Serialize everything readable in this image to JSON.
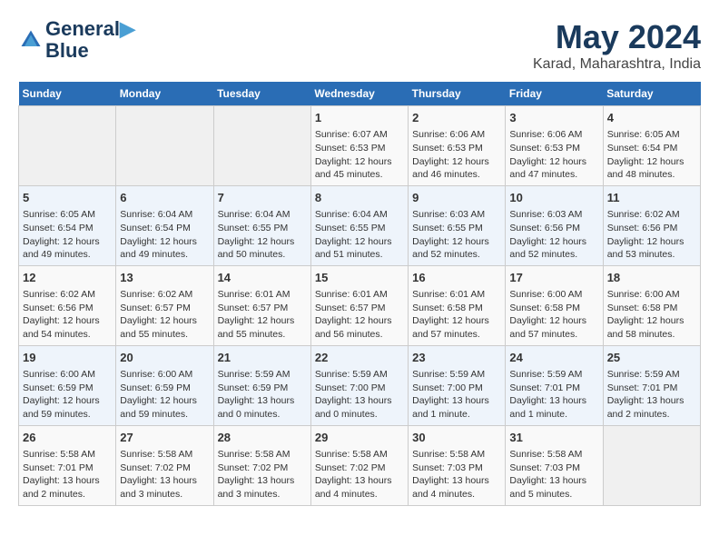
{
  "logo": {
    "line1": "General",
    "line2": "Blue"
  },
  "title": "May 2024",
  "subtitle": "Karad, Maharashtra, India",
  "days_of_week": [
    "Sunday",
    "Monday",
    "Tuesday",
    "Wednesday",
    "Thursday",
    "Friday",
    "Saturday"
  ],
  "weeks": [
    [
      {
        "day": "",
        "content": ""
      },
      {
        "day": "",
        "content": ""
      },
      {
        "day": "",
        "content": ""
      },
      {
        "day": "1",
        "content": "Sunrise: 6:07 AM\nSunset: 6:53 PM\nDaylight: 12 hours\nand 45 minutes."
      },
      {
        "day": "2",
        "content": "Sunrise: 6:06 AM\nSunset: 6:53 PM\nDaylight: 12 hours\nand 46 minutes."
      },
      {
        "day": "3",
        "content": "Sunrise: 6:06 AM\nSunset: 6:53 PM\nDaylight: 12 hours\nand 47 minutes."
      },
      {
        "day": "4",
        "content": "Sunrise: 6:05 AM\nSunset: 6:54 PM\nDaylight: 12 hours\nand 48 minutes."
      }
    ],
    [
      {
        "day": "5",
        "content": "Sunrise: 6:05 AM\nSunset: 6:54 PM\nDaylight: 12 hours\nand 49 minutes."
      },
      {
        "day": "6",
        "content": "Sunrise: 6:04 AM\nSunset: 6:54 PM\nDaylight: 12 hours\nand 49 minutes."
      },
      {
        "day": "7",
        "content": "Sunrise: 6:04 AM\nSunset: 6:55 PM\nDaylight: 12 hours\nand 50 minutes."
      },
      {
        "day": "8",
        "content": "Sunrise: 6:04 AM\nSunset: 6:55 PM\nDaylight: 12 hours\nand 51 minutes."
      },
      {
        "day": "9",
        "content": "Sunrise: 6:03 AM\nSunset: 6:55 PM\nDaylight: 12 hours\nand 52 minutes."
      },
      {
        "day": "10",
        "content": "Sunrise: 6:03 AM\nSunset: 6:56 PM\nDaylight: 12 hours\nand 52 minutes."
      },
      {
        "day": "11",
        "content": "Sunrise: 6:02 AM\nSunset: 6:56 PM\nDaylight: 12 hours\nand 53 minutes."
      }
    ],
    [
      {
        "day": "12",
        "content": "Sunrise: 6:02 AM\nSunset: 6:56 PM\nDaylight: 12 hours\nand 54 minutes."
      },
      {
        "day": "13",
        "content": "Sunrise: 6:02 AM\nSunset: 6:57 PM\nDaylight: 12 hours\nand 55 minutes."
      },
      {
        "day": "14",
        "content": "Sunrise: 6:01 AM\nSunset: 6:57 PM\nDaylight: 12 hours\nand 55 minutes."
      },
      {
        "day": "15",
        "content": "Sunrise: 6:01 AM\nSunset: 6:57 PM\nDaylight: 12 hours\nand 56 minutes."
      },
      {
        "day": "16",
        "content": "Sunrise: 6:01 AM\nSunset: 6:58 PM\nDaylight: 12 hours\nand 57 minutes."
      },
      {
        "day": "17",
        "content": "Sunrise: 6:00 AM\nSunset: 6:58 PM\nDaylight: 12 hours\nand 57 minutes."
      },
      {
        "day": "18",
        "content": "Sunrise: 6:00 AM\nSunset: 6:58 PM\nDaylight: 12 hours\nand 58 minutes."
      }
    ],
    [
      {
        "day": "19",
        "content": "Sunrise: 6:00 AM\nSunset: 6:59 PM\nDaylight: 12 hours\nand 59 minutes."
      },
      {
        "day": "20",
        "content": "Sunrise: 6:00 AM\nSunset: 6:59 PM\nDaylight: 12 hours\nand 59 minutes."
      },
      {
        "day": "21",
        "content": "Sunrise: 5:59 AM\nSunset: 6:59 PM\nDaylight: 13 hours\nand 0 minutes."
      },
      {
        "day": "22",
        "content": "Sunrise: 5:59 AM\nSunset: 7:00 PM\nDaylight: 13 hours\nand 0 minutes."
      },
      {
        "day": "23",
        "content": "Sunrise: 5:59 AM\nSunset: 7:00 PM\nDaylight: 13 hours\nand 1 minute."
      },
      {
        "day": "24",
        "content": "Sunrise: 5:59 AM\nSunset: 7:01 PM\nDaylight: 13 hours\nand 1 minute."
      },
      {
        "day": "25",
        "content": "Sunrise: 5:59 AM\nSunset: 7:01 PM\nDaylight: 13 hours\nand 2 minutes."
      }
    ],
    [
      {
        "day": "26",
        "content": "Sunrise: 5:58 AM\nSunset: 7:01 PM\nDaylight: 13 hours\nand 2 minutes."
      },
      {
        "day": "27",
        "content": "Sunrise: 5:58 AM\nSunset: 7:02 PM\nDaylight: 13 hours\nand 3 minutes."
      },
      {
        "day": "28",
        "content": "Sunrise: 5:58 AM\nSunset: 7:02 PM\nDaylight: 13 hours\nand 3 minutes."
      },
      {
        "day": "29",
        "content": "Sunrise: 5:58 AM\nSunset: 7:02 PM\nDaylight: 13 hours\nand 4 minutes."
      },
      {
        "day": "30",
        "content": "Sunrise: 5:58 AM\nSunset: 7:03 PM\nDaylight: 13 hours\nand 4 minutes."
      },
      {
        "day": "31",
        "content": "Sunrise: 5:58 AM\nSunset: 7:03 PM\nDaylight: 13 hours\nand 5 minutes."
      },
      {
        "day": "",
        "content": ""
      }
    ]
  ]
}
